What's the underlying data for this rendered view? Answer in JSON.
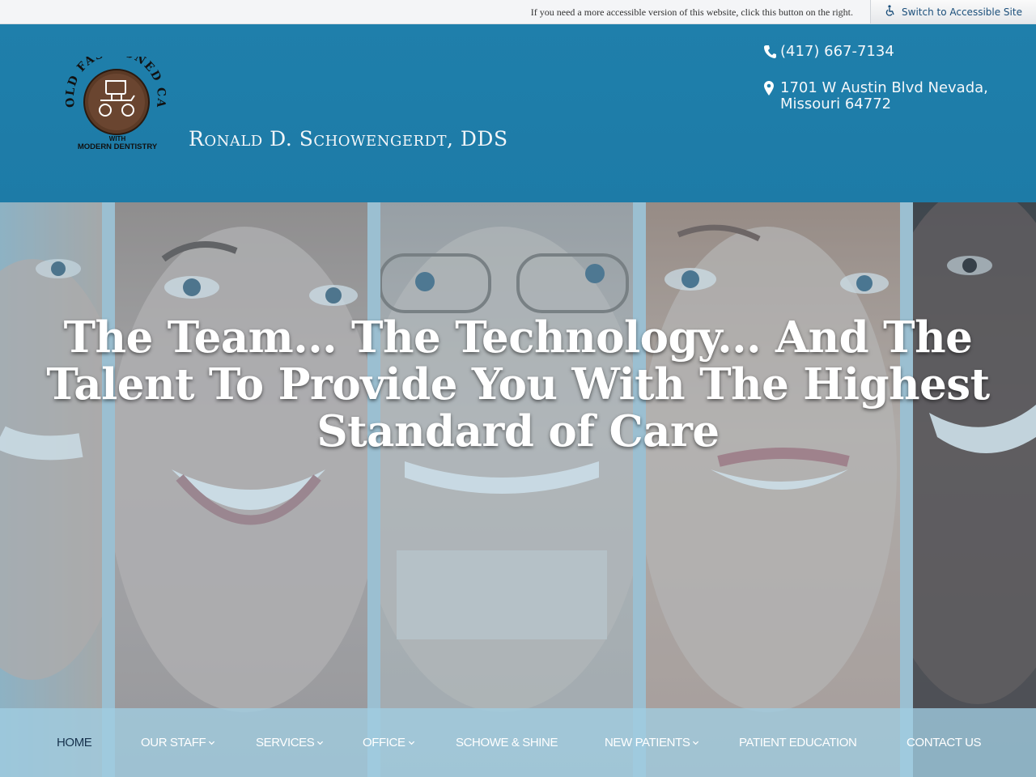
{
  "accessibility_bar": {
    "note": "If you need a more accessible version of this website, click this button on the right.",
    "button_label": "Switch to Accessible Site"
  },
  "header": {
    "logo": {
      "arc_text": "OLD FASHIONED CARING",
      "line1": "WITH",
      "line2": "MODERN DENTISTRY"
    },
    "practice_name": "Ronald D. Schowengerdt, DDS",
    "phone": "(417) 667-7134",
    "address": "1701 W Austin Blvd Nevada, Missouri 64772"
  },
  "hero": {
    "headline": "The Team... The Technology... And The Talent To Provide You With The Highest Standard of Care"
  },
  "nav": {
    "items": [
      {
        "label": "HOME",
        "active": true,
        "dropdown": false
      },
      {
        "label": "OUR STAFF",
        "active": false,
        "dropdown": true
      },
      {
        "label": "SERVICES",
        "active": false,
        "dropdown": true
      },
      {
        "label": "OFFICE",
        "active": false,
        "dropdown": true
      },
      {
        "label": "SCHOWE & SHINE",
        "active": false,
        "dropdown": false
      },
      {
        "label": "NEW PATIENTS",
        "active": false,
        "dropdown": true
      },
      {
        "label": "PATIENT EDUCATION",
        "active": false,
        "dropdown": false
      },
      {
        "label": "CONTACT US",
        "active": false,
        "dropdown": false
      }
    ]
  },
  "colors": {
    "header_blue": "#1f7fab",
    "nav_active": "#17324d",
    "nav_bg": "#a0cde1"
  },
  "icons": [
    "wheelchair-icon",
    "phone-icon",
    "map-marker-icon",
    "chevron-down-icon"
  ]
}
